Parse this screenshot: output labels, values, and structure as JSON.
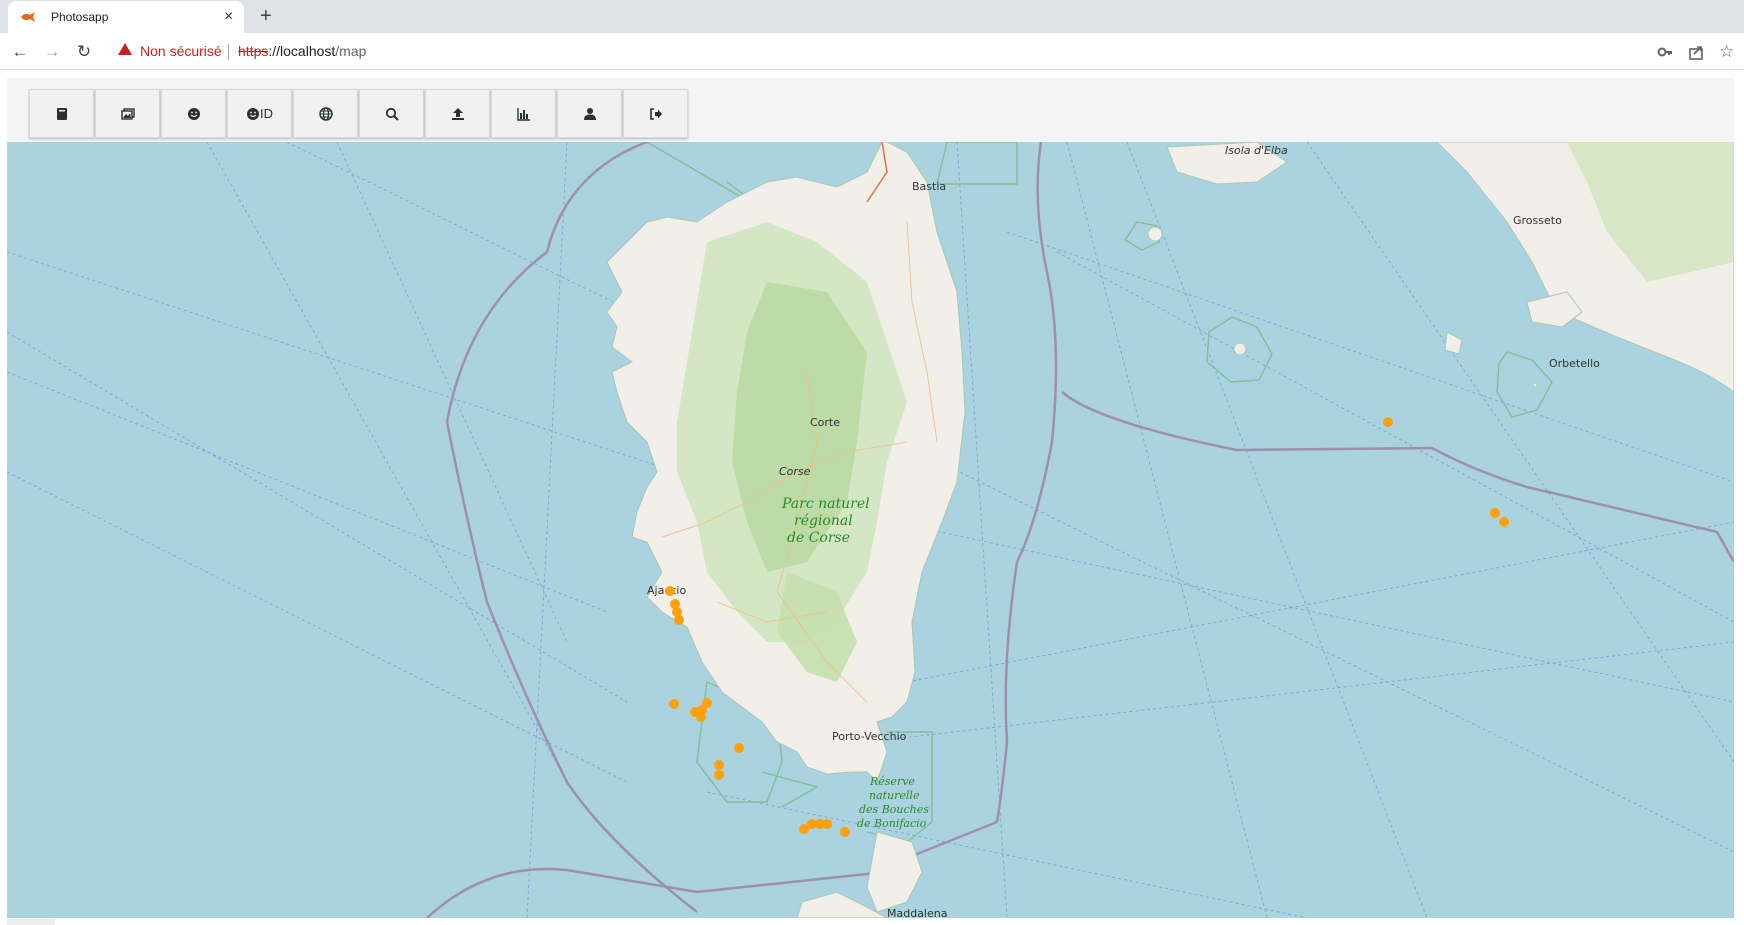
{
  "browser": {
    "tab_title": "Photosapp",
    "tab_close": "×",
    "new_tab": "+",
    "security_warning": "Non sécurisé",
    "url_scheme": "https",
    "url_host": "://localhost",
    "url_path": "/map"
  },
  "toolbar": {
    "buttons": [
      {
        "icon": "book-icon",
        "label": ""
      },
      {
        "icon": "images-icon",
        "label": ""
      },
      {
        "icon": "smile-icon",
        "label": ""
      },
      {
        "icon": "smile-id-icon",
        "label": "ID"
      },
      {
        "icon": "globe-icon",
        "label": ""
      },
      {
        "icon": "search-icon",
        "label": ""
      },
      {
        "icon": "upload-icon",
        "label": ""
      },
      {
        "icon": "chart-icon",
        "label": ""
      },
      {
        "icon": "user-icon",
        "label": ""
      },
      {
        "icon": "logout-icon",
        "label": ""
      }
    ]
  },
  "map": {
    "labels": {
      "isola_elba": "Isola d'Elba",
      "grosseto": "Grosseto",
      "bastia": "Bastia",
      "orbetello": "Orbetello",
      "corte": "Corte",
      "corse": "Corse",
      "park_line1": "Parc naturel",
      "park_line2": "régional",
      "park_line3": "de Corse",
      "ajaccio": "Ajaccio",
      "porto_vecchio": "Porto-Vecchio",
      "reserve_line1": "Réserve",
      "reserve_line2": "naturelle",
      "reserve_line3": "des Bouches",
      "reserve_line4": "de Bonifacio",
      "maddalena": "Maddalena"
    },
    "colors": {
      "sea": "#aad3df",
      "land": "#f2efe9",
      "forest": "#b9d9a3",
      "marker": "#ff9f0a",
      "border": "#9e8fae"
    }
  }
}
